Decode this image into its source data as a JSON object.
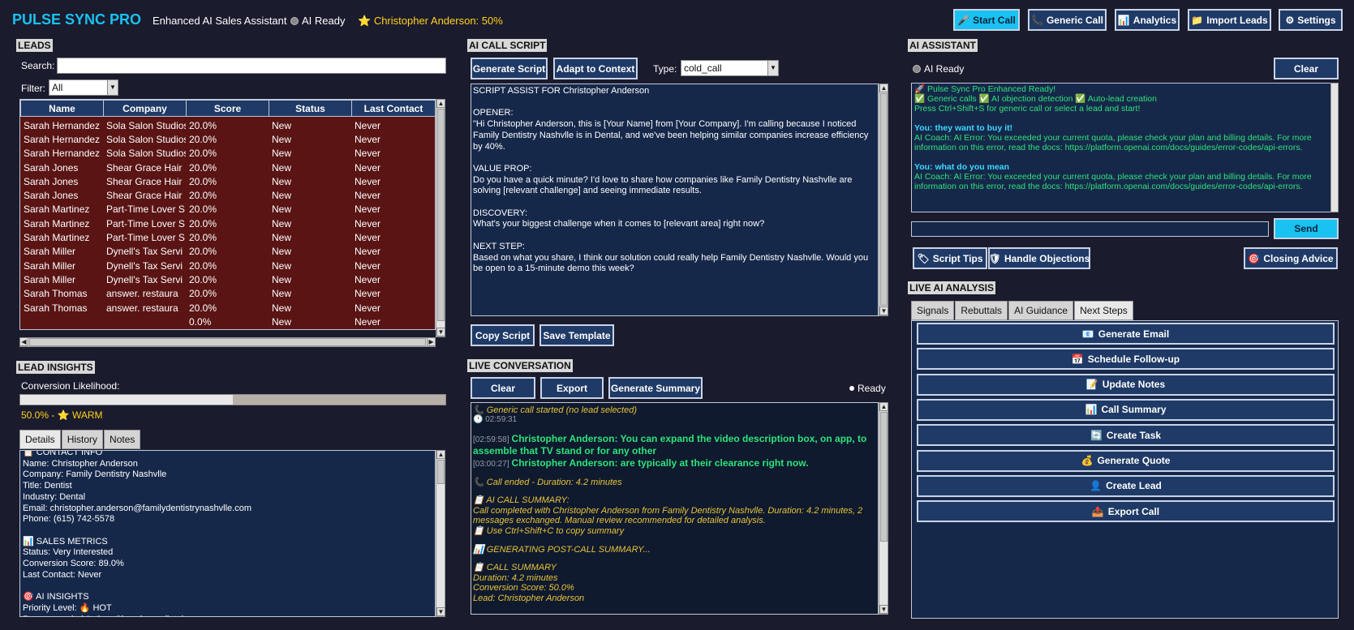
{
  "header": {
    "app_title": "PULSE SYNC PRO",
    "subtitle": "Enhanced AI Sales Assistant",
    "ai_status": "AI Ready",
    "current_lead": "Christopher Anderson: 50%",
    "buttons": {
      "start_call": "Start Call",
      "generic_call": "Generic Call",
      "analytics": "Analytics",
      "import_leads": "Import Leads",
      "settings": "Settings"
    }
  },
  "leads": {
    "section_title": "LEADS",
    "search_label": "Search:",
    "search_value": "",
    "filter_label": "Filter:",
    "filter_value": "All",
    "columns": [
      "Name",
      "Company",
      "Score",
      "Status",
      "Last Contact"
    ],
    "rows": [
      [
        "Sarah Hernandez",
        "Sola Salon Studios",
        "20.0%",
        "New",
        "Never"
      ],
      [
        "Sarah Hernandez",
        "Sola Salon Studios",
        "20.0%",
        "New",
        "Never"
      ],
      [
        "Sarah Hernandez",
        "Sola Salon Studios",
        "20.0%",
        "New",
        "Never"
      ],
      [
        "Sarah Jones",
        "Shear Grace Hair",
        "20.0%",
        "New",
        "Never"
      ],
      [
        "Sarah Jones",
        "Shear Grace Hair",
        "20.0%",
        "New",
        "Never"
      ],
      [
        "Sarah Jones",
        "Shear Grace Hair",
        "20.0%",
        "New",
        "Never"
      ],
      [
        "Sarah Martinez",
        "Part-Time Lover S",
        "20.0%",
        "New",
        "Never"
      ],
      [
        "Sarah Martinez",
        "Part-Time Lover S",
        "20.0%",
        "New",
        "Never"
      ],
      [
        "Sarah Martinez",
        "Part-Time Lover S",
        "20.0%",
        "New",
        "Never"
      ],
      [
        "Sarah Miller",
        "Dynell's Tax Servi",
        "20.0%",
        "New",
        "Never"
      ],
      [
        "Sarah Miller",
        "Dynell's Tax Servi",
        "20.0%",
        "New",
        "Never"
      ],
      [
        "Sarah Miller",
        "Dynell's Tax Servi",
        "20.0%",
        "New",
        "Never"
      ],
      [
        "Sarah Thomas",
        "answer. restaura",
        "20.0%",
        "New",
        "Never"
      ],
      [
        "Sarah Thomas",
        "answer. restaura",
        "20.0%",
        "New",
        "Never"
      ],
      [
        "",
        "",
        "0.0%",
        "New",
        "Never"
      ]
    ]
  },
  "insights": {
    "section_title": "LEAD INSIGHTS",
    "conversion_label": "Conversion Likelihood:",
    "conversion_fraction": 0.5,
    "conversion_text": "50.0% - ⭐ WARM",
    "tabs": [
      "Details",
      "History",
      "Notes"
    ],
    "details_text": "📋 CONTACT INFO\nName: Christopher Anderson\nCompany: Family Dentistry Nashvlle\nTitle: Dentist\nIndustry: Dental\nEmail: christopher.anderson@familydentistrynashvlle.com\nPhone: (615) 742-5578\n\n📊 SALES METRICS\nStatus: Very Interested\nConversion Score: 89.0%\nLast Contact: Never\n\n🎯 AI INSIGHTS\nPriority Level: 🔥 HOT\nRecommended Action: Close immediately"
  },
  "script": {
    "section_title": "AI CALL SCRIPT",
    "generate_button": "Generate Script",
    "adapt_button": "Adapt to Context",
    "type_label": "Type:",
    "type_value": "cold_call",
    "text": "SCRIPT ASSIST FOR Christopher Anderson\n\nOPENER:\n\"Hi Christopher Anderson, this is [Your Name] from [Your Company]. I'm calling because I noticed Family Dentistry Nashvlle is in Dental, and we've been helping similar companies increase efficiency by 40%.\n\nVALUE PROP:\nDo you have a quick minute? I'd love to share how companies like Family Dentistry Nashvlle are solving [relevant challenge] and seeing immediate results.\n\nDISCOVERY:\nWhat's your biggest challenge when it comes to [relevant area] right now?\n\nNEXT STEP:\nBased on what you share, I think our solution could really help Family Dentistry Nashvlle. Would you be open to a 15-minute demo this week?",
    "copy_button": "Copy Script",
    "save_button": "Save Template"
  },
  "conversation": {
    "section_title": "LIVE CONVERSATION",
    "clear_button": "Clear",
    "export_button": "Export",
    "summary_button": "Generate Summary",
    "status": "Ready",
    "lines": {
      "l1": "📞 Generic call started (no lead selected)",
      "l2": "🕐 02:59:31",
      "l3_time": "[02:59:58]",
      "l3_text": "Christopher Anderson: You can expand the video description box, on app, to assemble that TV stand or for any other",
      "l4_time": "[03:00:27]",
      "l4_text": "Christopher Anderson: are typically at their clearance right now.",
      "l5": "📞 Call ended - Duration: 4.2 minutes",
      "l6": "📋 AI CALL SUMMARY:\nCall completed with Christopher Anderson from Family Dentistry Nashvlle. Duration: 4.2 minutes, 2 messages exchanged. Manual review recommended for detailed analysis.\n📋 Use Ctrl+Shift+C to copy summary",
      "l7": "📊 GENERATING POST-CALL SUMMARY...",
      "l8": "📋 CALL SUMMARY\nDuration: 4.2 minutes\nConversion Score: 50.0%\nLead: Christopher Anderson"
    }
  },
  "assistant": {
    "section_title": "AI ASSISTANT",
    "status": "AI Ready",
    "clear_button": "Clear",
    "msg1": "🚀 Pulse Sync Pro Enhanced Ready!\n✅ Generic calls ✅ AI objection detection ✅ Auto-lead creation\nPress Ctrl+Shift+S for generic call or select a lead and start!",
    "you1": "You: they want to buy it!",
    "coach1": "AI Coach: AI Error: You exceeded your current quota, please check your plan and billing details. For more information on this error, read the docs: https://platform.openai.com/docs/guides/error-codes/api-errors.",
    "you2": "You: what do you mean",
    "coach2": "AI Coach: AI Error: You exceeded your current quota, please check your plan and billing details. For more information on this error, read the docs: https://platform.openai.com/docs/guides/error-codes/api-errors.",
    "input_value": "",
    "send_button": "Send",
    "script_tips": "Script Tips",
    "handle_objections": "Handle Objections",
    "closing_advice": "Closing Advice"
  },
  "analysis": {
    "section_title": "LIVE AI ANALYSIS",
    "tabs": [
      "Signals",
      "Rebuttals",
      "AI Guidance",
      "Next Steps"
    ],
    "actions": [
      {
        "icon": "📧",
        "label": "Generate Email"
      },
      {
        "icon": "📅",
        "label": "Schedule Follow-up"
      },
      {
        "icon": "📝",
        "label": "Update Notes"
      },
      {
        "icon": "📊",
        "label": "Call Summary"
      },
      {
        "icon": "🔄",
        "label": "Create Task"
      },
      {
        "icon": "💰",
        "label": "Generate Quote"
      },
      {
        "icon": "👤",
        "label": "Create Lead"
      },
      {
        "icon": "📤",
        "label": "Export Call"
      }
    ]
  },
  "colors": {
    "accent": "#19c2f0",
    "row_bg": "#5a1414",
    "panel_bg": "#16284a"
  }
}
